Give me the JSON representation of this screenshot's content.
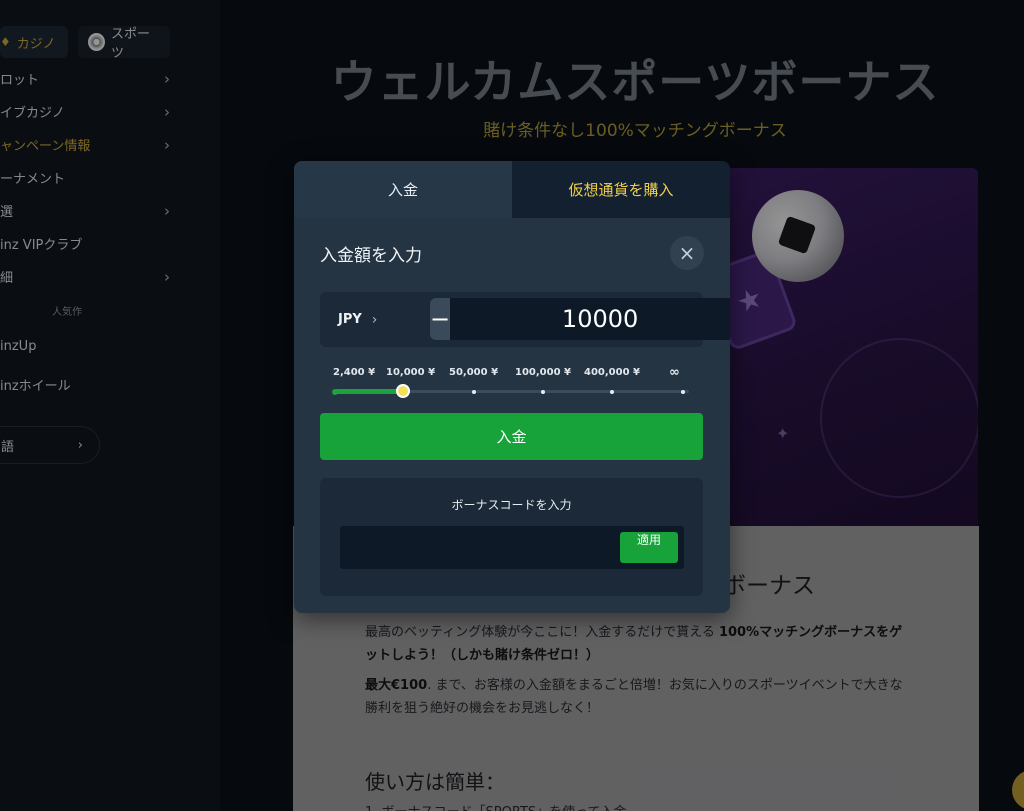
{
  "sidebar": {
    "tabs": {
      "casino": "カジノ",
      "sports": "スポーツ"
    },
    "items": [
      {
        "label": "ロット",
        "has_chevron": true
      },
      {
        "label": "イブカジノ",
        "has_chevron": true
      },
      {
        "label": "ャンペーン情報",
        "has_chevron": true
      },
      {
        "label": "ーナメント",
        "has_chevron": false
      },
      {
        "label": "選",
        "has_chevron": true
      },
      {
        "label": "inz VIPクラブ",
        "has_chevron": false
      },
      {
        "label": "細",
        "has_chevron": true
      }
    ],
    "section_label": "人気作",
    "extras": [
      "inzUp",
      "inzホイール"
    ],
    "language": "語"
  },
  "page": {
    "title": "ウェルカムスポーツボーナス",
    "subtitle": "賭け条件なし100%マッチングボーナス",
    "heading_partial": "グボーナス",
    "para1_normal": "最高のベッティング体験が今ここに！入金するだけで貰える ",
    "para1_bold": "100%マッチングボーナスをゲットしよう！（しかも賭け条件ゼロ！）",
    "para2_bold": "最大€100",
    "para2_normal": ". まで、お客様の入金額をまるごと倍増！お気に入りのスポーツイベントで大きな勝利を狙う絶好の機会をお見逃しなく！",
    "howto": "使い方は簡単：",
    "howto_item": "1. ボーナスコード「SPORTS」を使って入金"
  },
  "modal": {
    "tabs": {
      "deposit": "入金",
      "buy_crypto": "仮想通貨を購入"
    },
    "title": "入金額を入力",
    "close_icon": "×",
    "currency": "JPY",
    "amount": "10000",
    "minus": "−",
    "plus": "+",
    "presets": [
      "2,400 ¥",
      "10,000 ¥",
      "50,000 ¥",
      "100,000 ¥",
      "400,000 ¥",
      "∞"
    ],
    "slider_selected_index": 1,
    "deposit_button": "入金",
    "bonus_label": "ボーナスコードを入力",
    "bonus_value": "",
    "apply_button": "適用"
  },
  "colors": {
    "accent_green": "#18a23a",
    "gold": "#f1cf4c",
    "modal_bg": "#243443"
  }
}
